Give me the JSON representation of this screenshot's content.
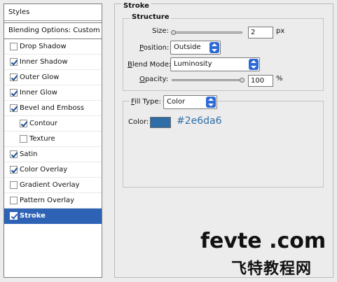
{
  "styles_panel": {
    "title": "Styles",
    "blending_options": "Blending Options: Custom",
    "items": [
      {
        "label": "Drop Shadow",
        "checked": false
      },
      {
        "label": "Inner Shadow",
        "checked": true
      },
      {
        "label": "Outer Glow",
        "checked": true
      },
      {
        "label": "Inner Glow",
        "checked": true
      },
      {
        "label": "Bevel and Emboss",
        "checked": true
      },
      {
        "label": "Contour",
        "checked": true
      },
      {
        "label": "Texture",
        "checked": false
      },
      {
        "label": "Satin",
        "checked": true
      },
      {
        "label": "Color Overlay",
        "checked": true
      },
      {
        "label": "Gradient Overlay",
        "checked": false
      },
      {
        "label": "Pattern Overlay",
        "checked": false
      },
      {
        "label": "Stroke",
        "checked": true
      }
    ]
  },
  "stroke": {
    "title": "Stroke",
    "structure_title": "Structure",
    "size_label": "Size:",
    "size_value": "2",
    "size_unit": "px",
    "size_level": 0.02,
    "position_label": "Position:",
    "position_value": "Outside",
    "blend_mode_label": "Blend Mode:",
    "blend_mode_value": "Luminosity",
    "opacity_label": "Opacity:",
    "opacity_value": "100",
    "opacity_unit": "%",
    "opacity_level": 1.0,
    "fill_type_label": "Fill Type:",
    "fill_type_value": "Color",
    "color_label": "Color:",
    "color_hex": "#2e6da6"
  },
  "watermark": {
    "line1": "fevte .com",
    "line2": "飞特教程网"
  }
}
